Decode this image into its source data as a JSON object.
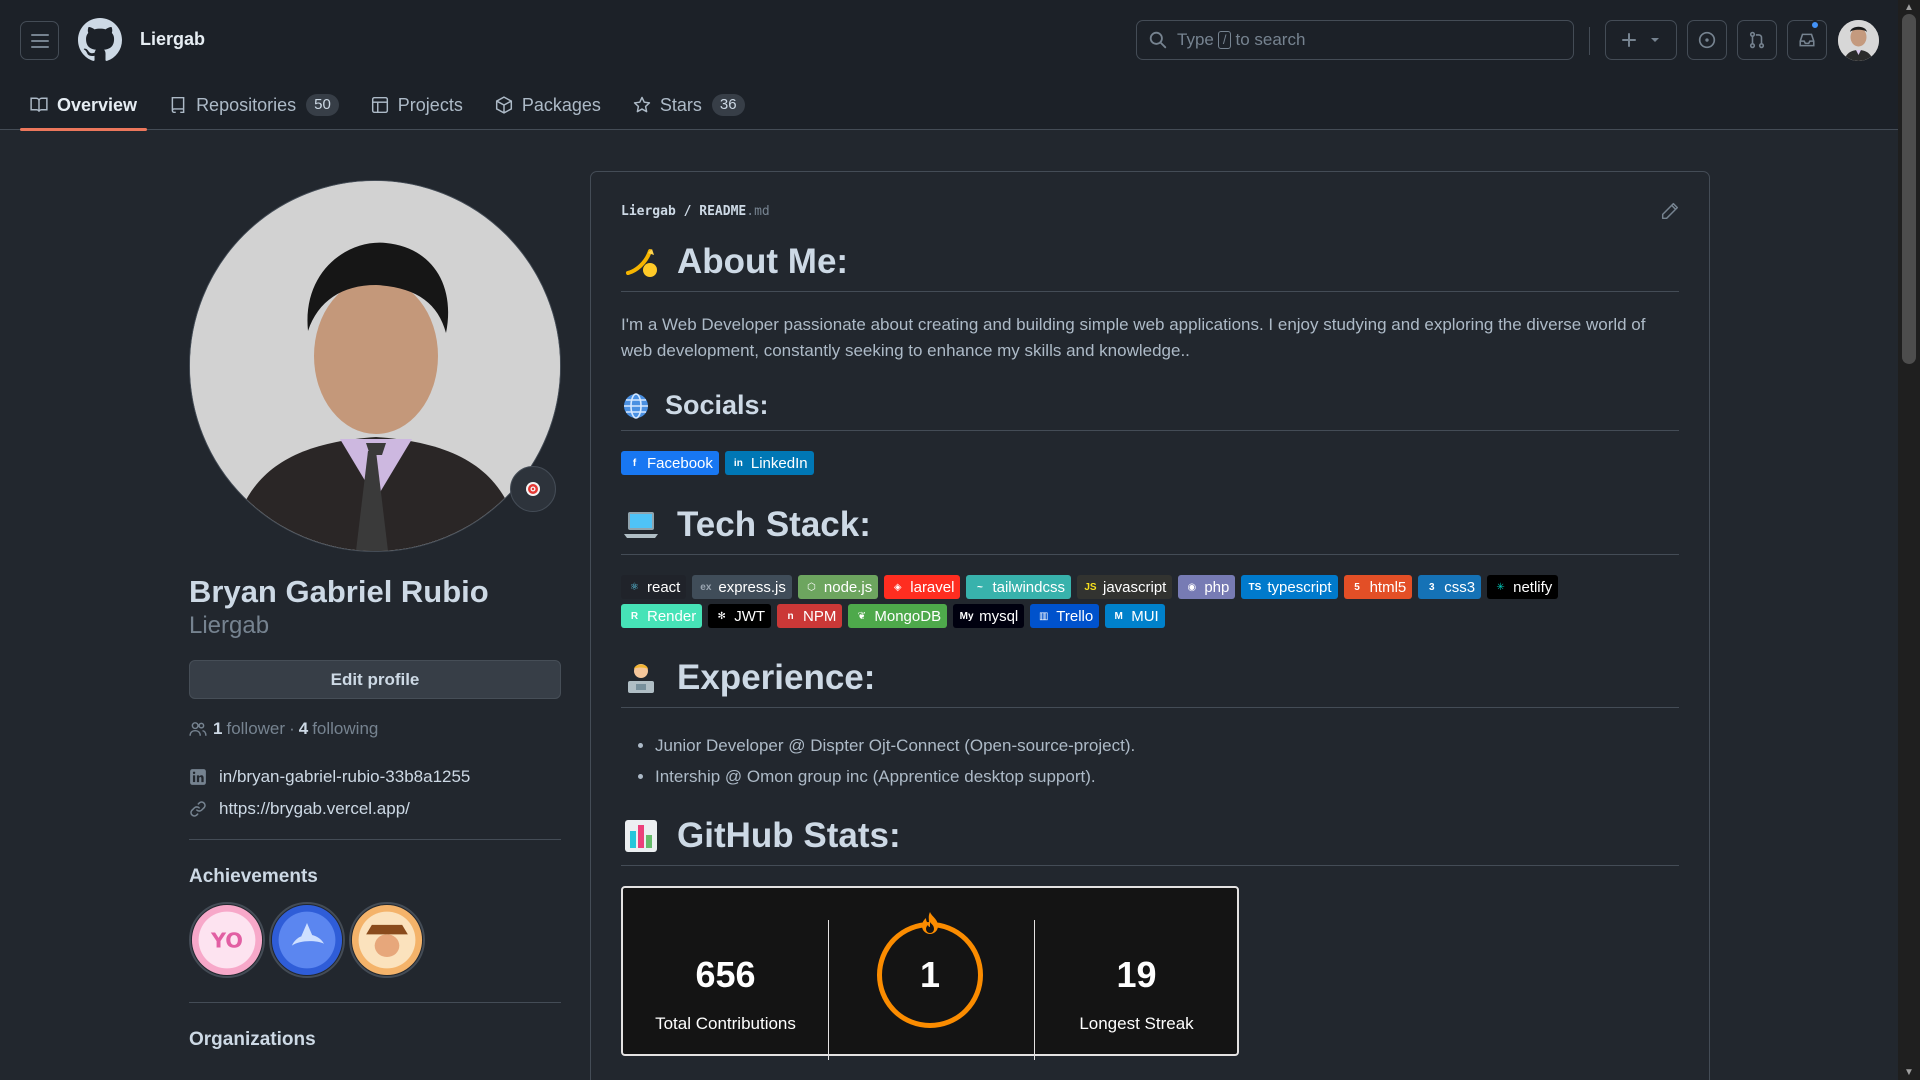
{
  "header": {
    "owner": "Liergab",
    "search_prefix": "Type",
    "search_key": "/",
    "search_suffix": "to search"
  },
  "tabs": [
    {
      "label": "Overview",
      "count": null,
      "active": true
    },
    {
      "label": "Repositories",
      "count": "50"
    },
    {
      "label": "Projects",
      "count": null
    },
    {
      "label": "Packages",
      "count": null
    },
    {
      "label": "Stars",
      "count": "36"
    }
  ],
  "profile": {
    "fullname": "Bryan Gabriel Rubio",
    "username": "Liergab",
    "edit_label": "Edit profile",
    "followers_count": "1",
    "followers_label": "follower",
    "sep": "·",
    "following_count": "4",
    "following_label": "following",
    "linkedin": "in/bryan-gabriel-rubio-33b8a1255",
    "website": "https://brygab.vercel.app/",
    "achievements_title": "Achievements",
    "organizations_title": "Organizations"
  },
  "readme": {
    "path_owner": "Liergab",
    "path_sep": "/",
    "path_file": "README",
    "path_ext": ".md",
    "about_title": "About Me:",
    "about_text": "I'm a Web Developer passionate about creating and building simple web applications. I enjoy studying and exploring the diverse world of web development, constantly seeking to enhance my skills and knowledge..",
    "socials_title": "Socials:",
    "socials": [
      {
        "label": "Facebook",
        "color": "#1877f2",
        "icon": "f"
      },
      {
        "label": "LinkedIn",
        "color": "#0077b5",
        "icon": "in"
      }
    ],
    "tech_title": "Tech Stack:",
    "tech": [
      {
        "label": "react",
        "color": "#20232a",
        "icon": "⚛",
        "ic": "#61dafb"
      },
      {
        "label": "express.js",
        "color": "#404d59",
        "icon": "ex",
        "ic": "#9aa5b1"
      },
      {
        "label": "node.js",
        "color": "#6da55f",
        "icon": "⬡",
        "ic": "#ffffff"
      },
      {
        "label": "laravel",
        "color": "#ff2d20",
        "icon": "◈",
        "ic": "#ffffff"
      },
      {
        "label": "tailwindcss",
        "color": "#38b2ac",
        "icon": "~",
        "ic": "#ffffff"
      },
      {
        "label": "javascript",
        "color": "#323330",
        "icon": "JS",
        "ic": "#f7df1e"
      },
      {
        "label": "php",
        "color": "#777bb4",
        "icon": "◉",
        "ic": "#ffffff"
      },
      {
        "label": "typescript",
        "color": "#007acc",
        "icon": "TS",
        "ic": "#ffffff"
      },
      {
        "label": "html5",
        "color": "#e34f26",
        "icon": "5",
        "ic": "#ffffff"
      },
      {
        "label": "css3",
        "color": "#1572b6",
        "icon": "3",
        "ic": "#ffffff"
      },
      {
        "label": "netlify",
        "color": "#000000",
        "icon": "✳",
        "ic": "#00c7b7"
      },
      {
        "label": "Render",
        "color": "#46e3b7",
        "icon": "R",
        "ic": "#ffffff"
      },
      {
        "label": "JWT",
        "color": "#000000",
        "icon": "✻",
        "ic": "#ffffff"
      },
      {
        "label": "NPM",
        "color": "#cb3837",
        "icon": "n",
        "ic": "#ffffff"
      },
      {
        "label": "MongoDB",
        "color": "#4ea94b",
        "icon": "❦",
        "ic": "#ffffff"
      },
      {
        "label": "mysql",
        "color": "#00000f",
        "icon": "My",
        "ic": "#ffffff"
      },
      {
        "label": "Trello",
        "color": "#0052cc",
        "icon": "▥",
        "ic": "#ffffff"
      },
      {
        "label": "MUI",
        "color": "#0081cb",
        "icon": "M",
        "ic": "#ffffff"
      }
    ],
    "experience_title": "Experience:",
    "experience": [
      "Junior Developer @ Dispter Ojt-Connect (Open-source-project).",
      "Intership @ Omon group inc (Apprentice desktop support)."
    ],
    "stats_title": "GitHub Stats:",
    "stats": {
      "total_value": "656",
      "total_label": "Total Contributions",
      "current_value": "1",
      "longest_value": "19",
      "longest_label": "Longest Streak"
    }
  },
  "colors": {
    "accent": "#ec775c",
    "ring": "#fb8c00"
  }
}
